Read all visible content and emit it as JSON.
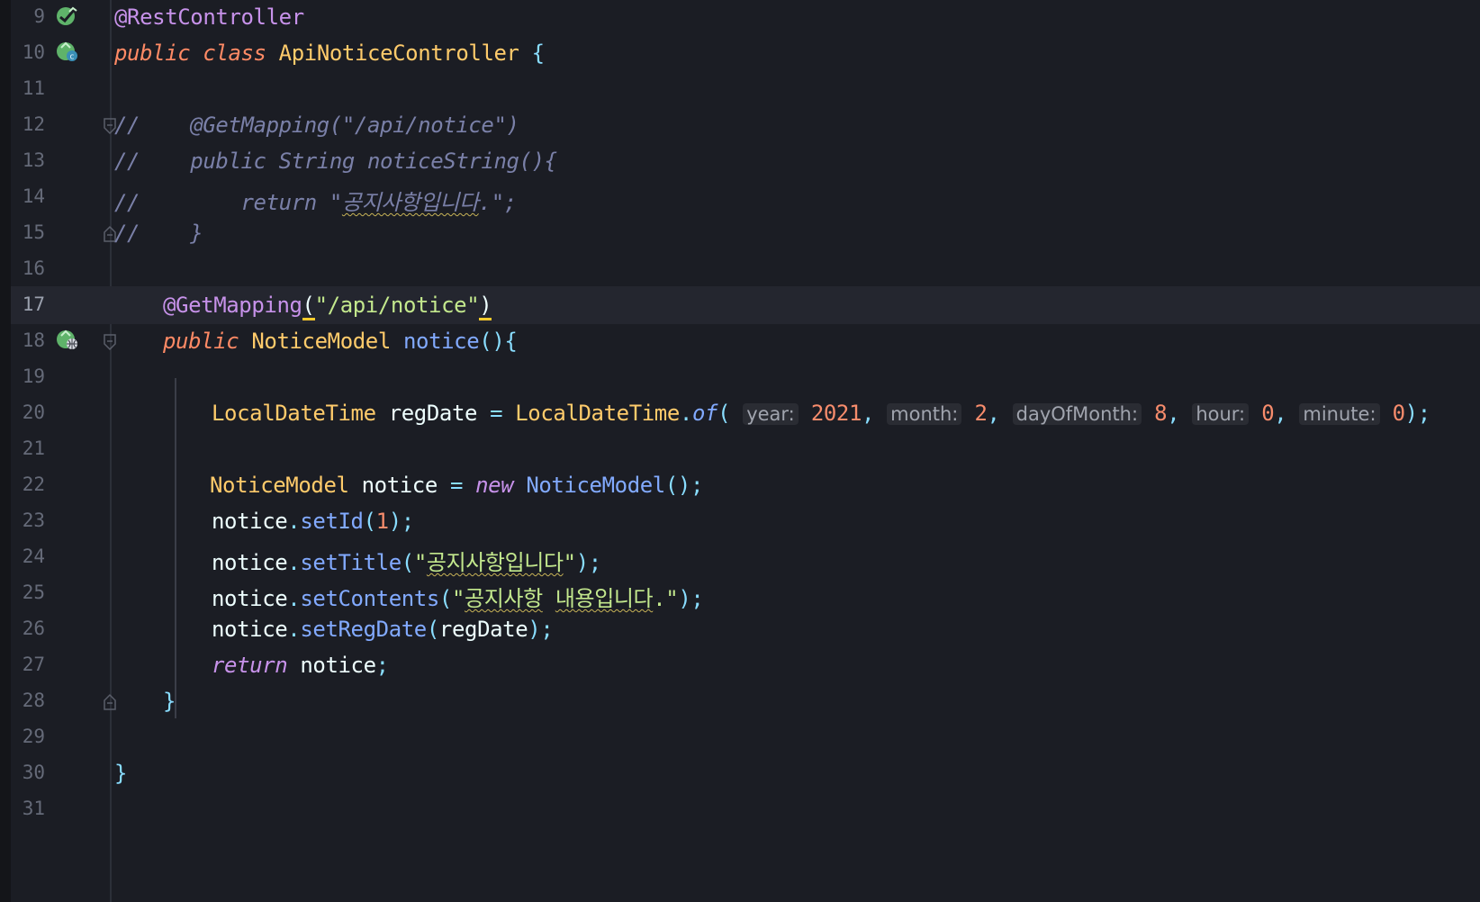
{
  "editor": {
    "language": "java",
    "current_line": 17,
    "lines": [
      {
        "n": "9",
        "text": "@RestController"
      },
      {
        "n": "10",
        "text": "public class ApiNoticeController {"
      },
      {
        "n": "11",
        "text": ""
      },
      {
        "n": "12",
        "text": "//    @GetMapping(\"/api/notice\")"
      },
      {
        "n": "13",
        "text": "//    public String noticeString(){"
      },
      {
        "n": "14",
        "text": "//        return \"공지사항입니다.\";"
      },
      {
        "n": "15",
        "text": "//    }"
      },
      {
        "n": "16",
        "text": ""
      },
      {
        "n": "17",
        "text": "    @GetMapping(\"/api/notice\")"
      },
      {
        "n": "18",
        "text": "    public NoticeModel notice(){"
      },
      {
        "n": "19",
        "text": ""
      },
      {
        "n": "20",
        "text": "        LocalDateTime regDate = LocalDateTime.of( year: 2021,  month: 2,  dayOfMonth: 8,  hour: 0,  minute: 0);"
      },
      {
        "n": "21",
        "text": ""
      },
      {
        "n": "22",
        "text": "        NoticeModel notice = new NoticeModel();"
      },
      {
        "n": "23",
        "text": "        notice.setId(1);"
      },
      {
        "n": "24",
        "text": "        notice.setTitle(\"공지사항입니다\");"
      },
      {
        "n": "25",
        "text": "        notice.setContents(\"공지사항 내용입니다.\");"
      },
      {
        "n": "26",
        "text": "        notice.setRegDate(regDate);"
      },
      {
        "n": "27",
        "text": "        return notice;"
      },
      {
        "n": "28",
        "text": "    }"
      },
      {
        "n": "29",
        "text": ""
      },
      {
        "n": "30",
        "text": "}"
      },
      {
        "n": "31",
        "text": ""
      }
    ],
    "gutter_icons": [
      {
        "line": "9",
        "icon": "spring-bean-checkmark-icon"
      },
      {
        "line": "10",
        "icon": "spring-bean-class-icon"
      },
      {
        "line": "18",
        "icon": "spring-web-endpoint-icon"
      }
    ],
    "tokens": {
      "rest_controller": "@RestController",
      "public": "public",
      "class": "class",
      "class_name": "ApiNoticeController",
      "open_brace": "{",
      "close_brace": "}",
      "comment_12": "//    @GetMapping(\"/api/notice\")",
      "comment_13": "//    public String noticeString(){",
      "comment_14_a": "//        return \"",
      "comment_14_korean": "공지사항입니다",
      "comment_14_b": ".\";",
      "comment_15": "//    }",
      "get_mapping": "@GetMapping",
      "paren_open": "(",
      "paren_close": ")",
      "mapping_path": "\"/api/notice\"",
      "notice_model": "NoticeModel",
      "method_notice": "notice",
      "parens_brace": "(){",
      "local_date_time": "LocalDateTime",
      "reg_date": "regDate",
      "equals": "=",
      "dot": ".",
      "of": "of",
      "comma": ",",
      "semicolon_paren": ");",
      "hint_year": "year:",
      "val_year": "2021",
      "hint_month": "month:",
      "val_month": "2",
      "hint_day": "dayOfMonth:",
      "val_day": "8",
      "hint_hour": "hour:",
      "val_hour": "0",
      "hint_minute": "minute:",
      "val_minute": "0",
      "notice_var": "notice",
      "new": "new",
      "ctor_call": "();",
      "set_id": "setId",
      "id_value": "1",
      "set_title": "setTitle",
      "quote": "\"",
      "title_korean": "공지사항입니다",
      "set_contents": "setContents",
      "contents_korean_1": "공지사항",
      "contents_korean_2": "내용입니다",
      "contents_tail": ".\"",
      "set_reg_date": "setRegDate",
      "return": "return",
      "semicolon": ";"
    }
  }
}
